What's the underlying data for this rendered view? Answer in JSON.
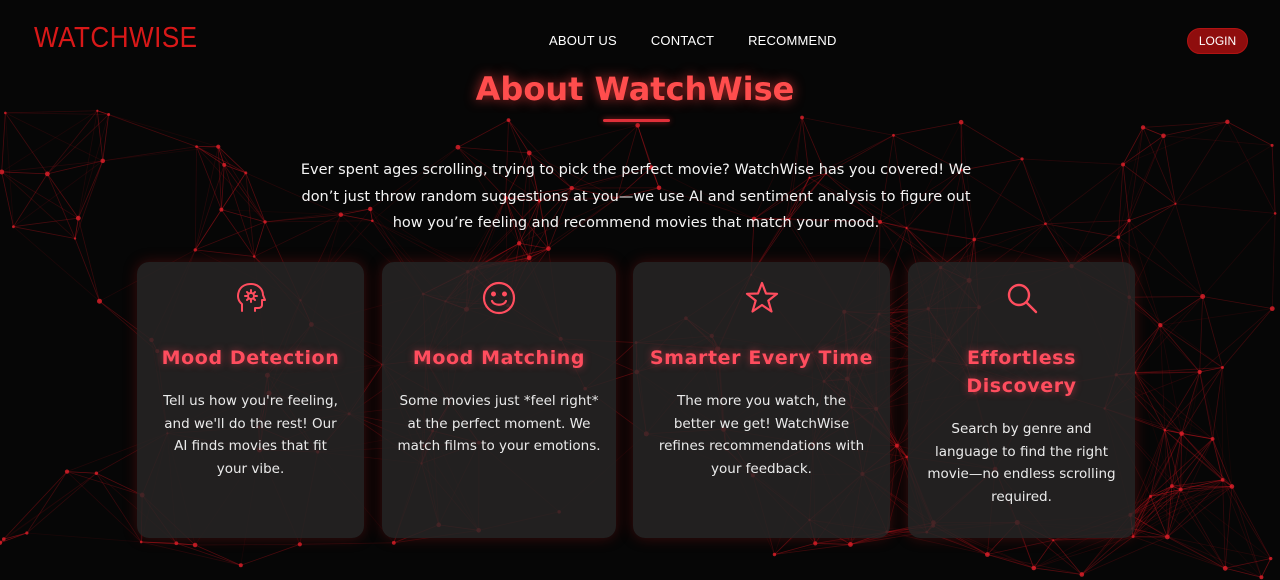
{
  "brand": "WATCHWISE",
  "nav": {
    "items": [
      "ABOUT US",
      "CONTACT",
      "RECOMMEND"
    ],
    "login_label": "LOGIN"
  },
  "about": {
    "title": "About WatchWise",
    "intro": "Ever spent ages scrolling, trying to pick the perfect movie? WatchWise has you covered! We don’t just throw random suggestions at you—we use AI and sentiment analysis to figure out how you’re feeling and recommend movies that match your mood."
  },
  "features": [
    {
      "icon": "brain-head-icon",
      "title": "Mood Detection",
      "text": "Tell us how you're feeling, and we'll do the rest! Our AI finds movies that fit your vibe."
    },
    {
      "icon": "smiley-icon",
      "title": "Mood Matching",
      "text": "Some movies just *feel right* at the perfect moment. We match films to your emotions."
    },
    {
      "icon": "star-icon",
      "title": "Smarter Every Time",
      "text": "The more you watch, the better we get! WatchWise refines recommendations with your feedback."
    },
    {
      "icon": "search-icon",
      "title": "Effortless Discovery",
      "text": "Search by genre and language to find the right movie—no endless scrolling required."
    }
  ],
  "colors": {
    "background": "#060606",
    "brand": "#d81818",
    "accent": "#ff4d5e",
    "card": "#282626",
    "login_button": "#8f0d0d"
  }
}
